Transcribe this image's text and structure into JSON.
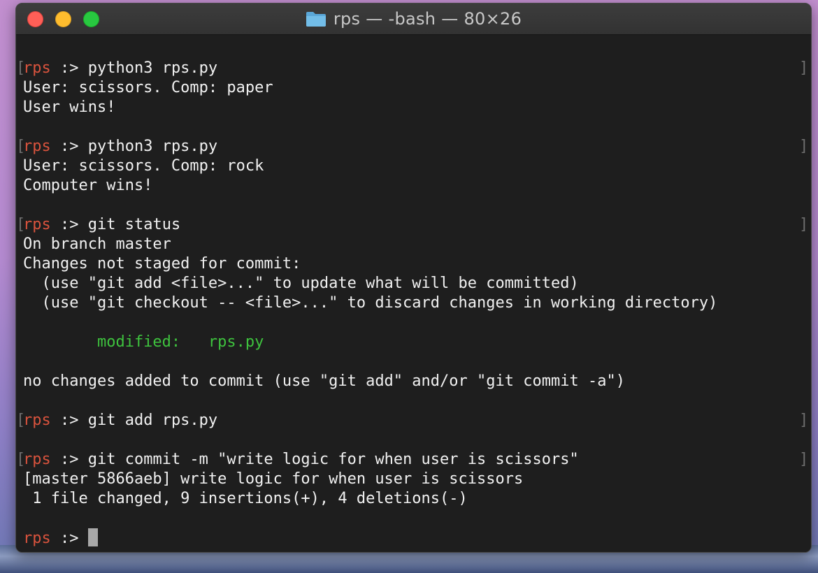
{
  "window": {
    "title": "rps — -bash — 80×26"
  },
  "prompt": {
    "name": "rps",
    "symbol": ":>"
  },
  "terminal": {
    "lines": [
      {
        "type": "prompt",
        "cmd": "python3 rps.py"
      },
      {
        "type": "out",
        "text": "User: scissors. Comp: paper"
      },
      {
        "type": "out",
        "text": "User wins!"
      },
      {
        "type": "blank"
      },
      {
        "type": "prompt",
        "cmd": "python3 rps.py"
      },
      {
        "type": "out",
        "text": "User: scissors. Comp: rock"
      },
      {
        "type": "out",
        "text": "Computer wins!"
      },
      {
        "type": "blank"
      },
      {
        "type": "prompt",
        "cmd": "git status"
      },
      {
        "type": "out",
        "text": "On branch master"
      },
      {
        "type": "out",
        "text": "Changes not staged for commit:"
      },
      {
        "type": "out",
        "text": "  (use \"git add <file>...\" to update what will be committed)"
      },
      {
        "type": "out",
        "text": "  (use \"git checkout -- <file>...\" to discard changes in working directory)"
      },
      {
        "type": "blank"
      },
      {
        "type": "green",
        "text": "        modified:   rps.py"
      },
      {
        "type": "blank"
      },
      {
        "type": "out",
        "text": "no changes added to commit (use \"git add\" and/or \"git commit -a\")"
      },
      {
        "type": "blank"
      },
      {
        "type": "prompt",
        "cmd": "git add rps.py"
      },
      {
        "type": "blank"
      },
      {
        "type": "prompt",
        "cmd": "git commit -m \"write logic for when user is scissors\""
      },
      {
        "type": "out",
        "text": "[master 5866aeb] write logic for when user is scissors"
      },
      {
        "type": "out",
        "text": " 1 file changed, 9 insertions(+), 4 deletions(-)"
      },
      {
        "type": "blank"
      },
      {
        "type": "current"
      }
    ]
  },
  "colors": {
    "background": "#1e1e1e",
    "text": "#f1f1f1",
    "prompt_name": "#d9533d",
    "git_modified": "#3ec23e",
    "cursor": "#a8a8a8"
  },
  "icons": {
    "title": "folder-icon"
  }
}
